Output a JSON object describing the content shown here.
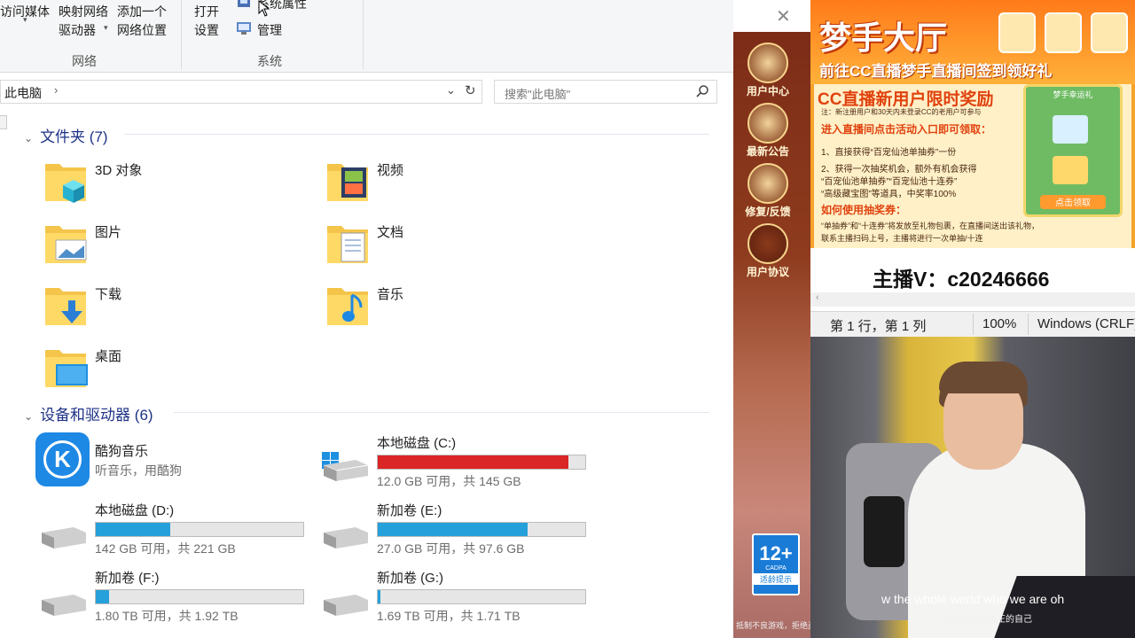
{
  "ribbon": {
    "media_access": "访问媒体",
    "map_drive_1": "映射网络",
    "map_drive_2": "驱动器",
    "add_location_1": "添加一个",
    "add_location_2": "网络位置",
    "open": "打开",
    "settings": "设置",
    "system_props": "系统属性",
    "manage": "管理",
    "group_network": "网络",
    "group_system": "系统"
  },
  "address": {
    "path": "此电脑",
    "search_placeholder": "搜索\"此电脑\""
  },
  "folders_section": {
    "title": "文件夹 (7)"
  },
  "folders": [
    {
      "name": "3D 对象",
      "icon": "3d-objects-folder-icon"
    },
    {
      "name": "视频",
      "icon": "videos-folder-icon"
    },
    {
      "name": "图片",
      "icon": "pictures-folder-icon"
    },
    {
      "name": "文档",
      "icon": "documents-folder-icon"
    },
    {
      "name": "下载",
      "icon": "downloads-folder-icon"
    },
    {
      "name": "音乐",
      "icon": "music-folder-icon"
    },
    {
      "name": "桌面",
      "icon": "desktop-folder-icon"
    }
  ],
  "devices_section": {
    "title": "设备和驱动器 (6)"
  },
  "app_device": {
    "name": "酷狗音乐",
    "desc": "听音乐，用酷狗",
    "brand_color": "#1e88e5",
    "logo_letter": "K"
  },
  "drives": [
    {
      "name": "本地磁盘 (C:)",
      "info": "12.0 GB 可用，共 145 GB",
      "used": 0.917,
      "color": "#da2626"
    },
    {
      "name": "本地磁盘 (D:)",
      "info": "142 GB 可用，共 221 GB",
      "used": 0.357,
      "color": "#26a0da"
    },
    {
      "name": "新加卷 (E:)",
      "info": "27.0 GB 可用，共 97.6 GB",
      "used": 0.723,
      "color": "#26a0da"
    },
    {
      "name": "新加卷 (F:)",
      "info": "1.80 TB 可用，共 1.92 TB",
      "used": 0.063,
      "color": "#26a0da"
    },
    {
      "name": "新加卷 (G:)",
      "info": "1.69 TB 可用，共 1.71 TB",
      "used": 0.012,
      "color": "#26a0da"
    }
  ],
  "game_sidebar": {
    "items": [
      "用户中心",
      "最新公告",
      "修复/反馈",
      "用户协议"
    ],
    "cadpa_age": "12+",
    "cadpa_label": "CADPA",
    "cadpa_tip": "适龄提示",
    "footer_note": "抵制不良游戏，拒绝盗版游戏，注意自我保护，谨防受骗上当。"
  },
  "banner": {
    "title": "梦手大厅",
    "subtitle": "前往CC直播梦手直播间签到领好礼",
    "heading": "CC直播新用户限时奖励",
    "note": "注：新注册用户和30天内未登录CC的老用户可参与",
    "enter": "进入直播间点击活动入口即可领取：",
    "line1": "1、直接获得“百宠仙池单抽券”一份",
    "line2": "2、获得一次抽奖机会，额外有机会获得",
    "line3": "“百宠仙池单抽券”“百宠仙池十连券”",
    "line4": "“高级藏宝图”等道具，中奖率100%",
    "how": "如何使用抽奖券：",
    "line5": "“单抽券”和“十连券”将发放至礼物包裹，在直播间送出该礼物，",
    "line6": "联系主播扫码上号，主播将进行一次单抽/十连",
    "card_title": "梦手幸运礼",
    "card_btn": "点击领取"
  },
  "notepad": {
    "content": "主播V：c20246666",
    "status_pos": "第 1 行，第 1 列",
    "status_zoom": "100%",
    "status_eol": "Windows (CRLF)"
  },
  "stream": {
    "subtitle_en": "w the whole world who we are oh",
    "subtitle_cn": "向世界展现真正的自己"
  }
}
